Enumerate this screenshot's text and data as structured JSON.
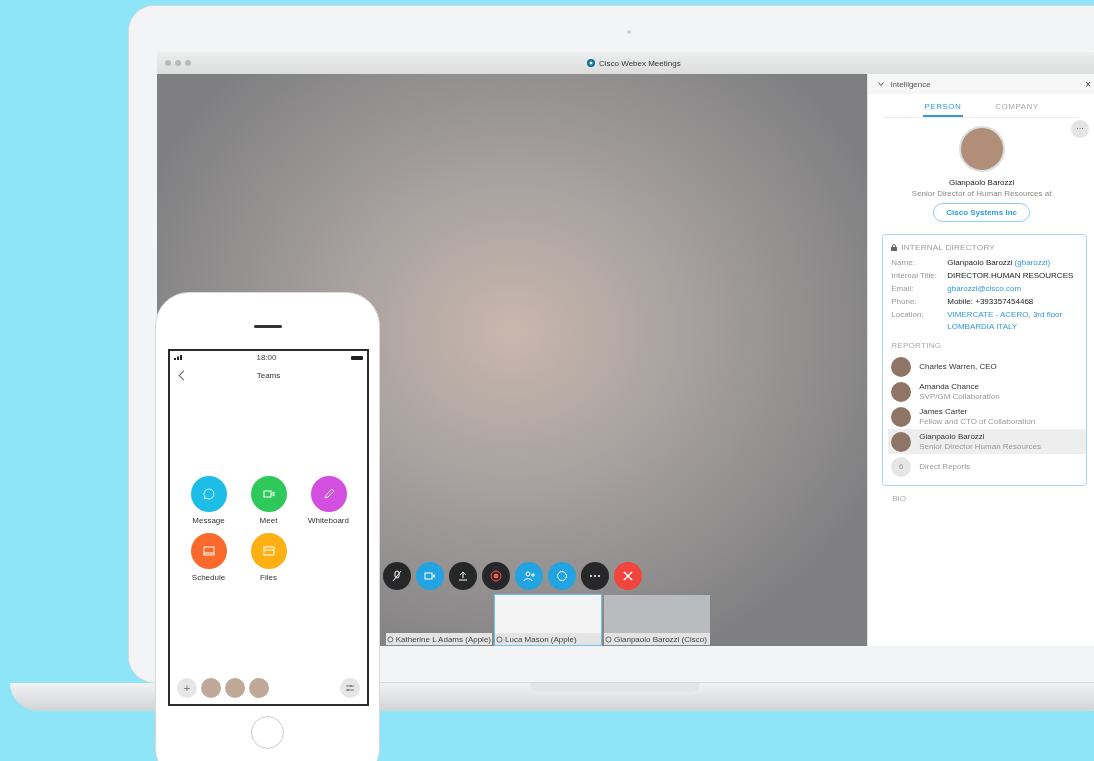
{
  "window": {
    "title": "Cisco Webex Meetings"
  },
  "video": {
    "controls": [
      {
        "kind": "mute"
      },
      {
        "kind": "camera"
      },
      {
        "kind": "share"
      },
      {
        "kind": "record"
      },
      {
        "kind": "participants"
      },
      {
        "kind": "chat"
      },
      {
        "kind": "more"
      },
      {
        "kind": "end"
      }
    ],
    "thumbnails": [
      {
        "label": "Katherine L Adams (Apple)",
        "selected": false
      },
      {
        "label": "Luca Mason (Apple)",
        "selected": true
      },
      {
        "label": "Gianpaolo Barozzi (Cisco)",
        "selected": false
      }
    ]
  },
  "sidebar": {
    "header": "Intelligence",
    "close": "×",
    "tabs": [
      {
        "label": "PERSON",
        "selected": true
      },
      {
        "label": "COMPANY",
        "selected": false
      }
    ],
    "more": "···",
    "profile": {
      "name": "Gianpaolo Barozzi",
      "title": "Senior Director of Human Resources at",
      "company": "Cisco Systems Inc"
    },
    "directory": {
      "heading": "INTERNAL DIRECTORY",
      "fields": [
        {
          "label": "Name:",
          "values": [
            "Gianpaolo Barozzi"
          ],
          "handle": "(gbarozzi)",
          "kind": "plain"
        },
        {
          "label": "Internal Title:",
          "values": [
            "DIRECTOR.HUMAN RESOURCES"
          ],
          "kind": "plain"
        },
        {
          "label": "Email:",
          "values": [
            "gbarozzi@cisco.com"
          ],
          "kind": "link"
        },
        {
          "label": "Phone:",
          "values": [
            "Mobile: +393357454468"
          ],
          "kind": "plain"
        },
        {
          "label": "Location:",
          "values": [
            "VIMERCATE - ACERO, 3rd floor",
            "LOMBARDIA  ITALY"
          ],
          "kind": "link"
        }
      ],
      "reporting_heading": "REPORTING",
      "people": [
        {
          "name": "Charles Warren, CEO",
          "selected": false
        },
        {
          "name": "Amanda Chance",
          "role": "SVP/GM Collaboration",
          "selected": false
        },
        {
          "name": "James Carter",
          "role": "Fellow and CTO of Collaboration",
          "selected": false
        },
        {
          "name": "Gianpaolo Barozzi",
          "role": "Senior Director Human Resources",
          "selected": true
        }
      ],
      "reports_count": "6",
      "reports_label": "Direct Reports"
    },
    "bio_heading": "BIO"
  },
  "phone": {
    "time": "18:00",
    "title": "Teams",
    "apps": [
      {
        "label": "Message",
        "color": "#1cbde6",
        "kind": "message"
      },
      {
        "label": "Meet",
        "color": "#2ec95a",
        "kind": "meet"
      },
      {
        "label": "Whiteboard",
        "color": "#d24fe0",
        "kind": "whiteboard"
      },
      {
        "label": "Schedule",
        "color": "#fb6a2c",
        "kind": "schedule"
      },
      {
        "label": "Files",
        "color": "#fdb013",
        "kind": "files"
      }
    ],
    "add": "+"
  }
}
